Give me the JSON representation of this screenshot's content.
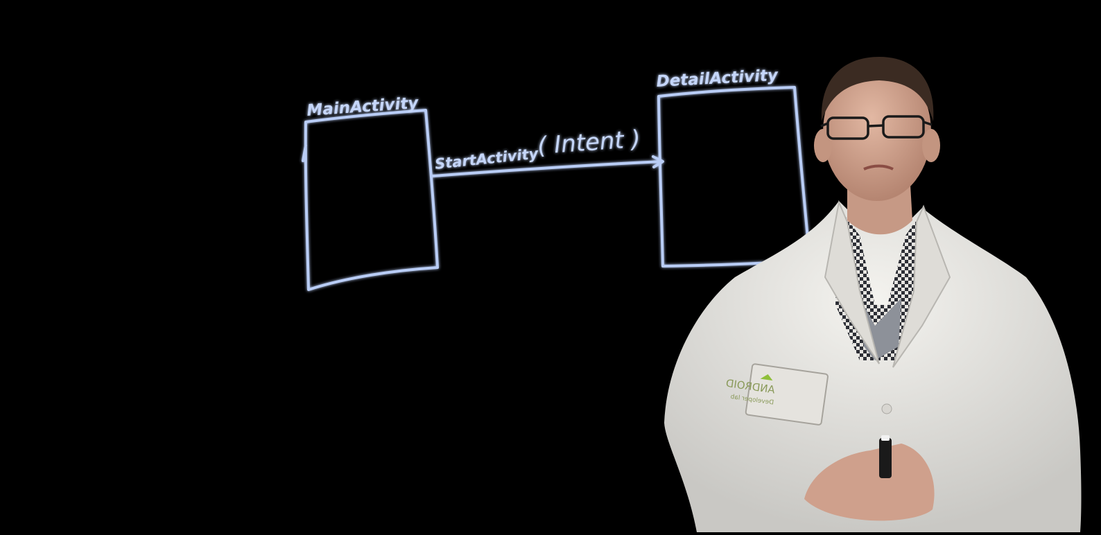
{
  "diagram": {
    "left_box_label": "MainActivity",
    "right_box_label": "DetailActivity",
    "arrow_label_call": "StartActivity",
    "arrow_label_arg": "( Intent )"
  },
  "badge": {
    "brand": "ANDROID",
    "subtitle": "Developer lab"
  },
  "colors": {
    "background": "#000000",
    "glow_stroke": "#b9cdf6",
    "coat": "#ecebe7",
    "shirt_dark": "#30323a",
    "skin": "#cfa590"
  }
}
